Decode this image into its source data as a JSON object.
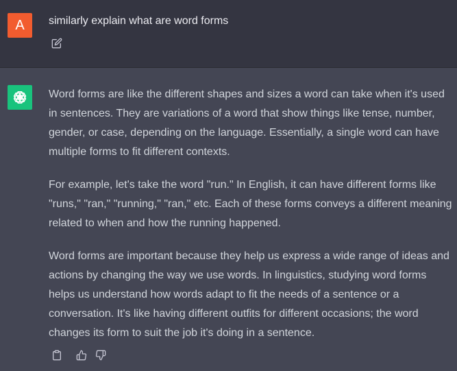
{
  "conversation": {
    "user_message": {
      "avatar_letter": "A",
      "text": "similarly explain what are word forms",
      "edit_icon": "edit-icon"
    },
    "assistant_message": {
      "avatar_icon": "openai-logo-icon",
      "paragraphs": [
        "Word forms are like the different shapes and sizes a word can take when it's used in sentences. They are variations of a word that show things like tense, number, gender, or case, depending on the language. Essentially, a single word can have multiple forms to fit different contexts.",
        "For example, let's take the word \"run.\" In English, it can have different forms like \"runs,\" \"ran,\" \"running,\" \"ran,\" etc. Each of these forms conveys a different meaning related to when and how the running happened.",
        "Word forms are important because they help us express a wide range of ideas and actions by changing the way we use words. In linguistics, studying word forms helps us understand how words adapt to fit the needs of a sentence or a conversation. It's like having different outfits for different occasions; the word changes its form to suit the job it's doing in a sentence."
      ],
      "actions": [
        "clipboard-icon",
        "thumbs-up-icon",
        "thumbs-down-icon"
      ]
    }
  },
  "colors": {
    "user_background": "#343541",
    "assistant_background": "#444654",
    "user_avatar": "#f25c2f",
    "assistant_avatar": "#19c37d",
    "text": "#d1d5db"
  }
}
